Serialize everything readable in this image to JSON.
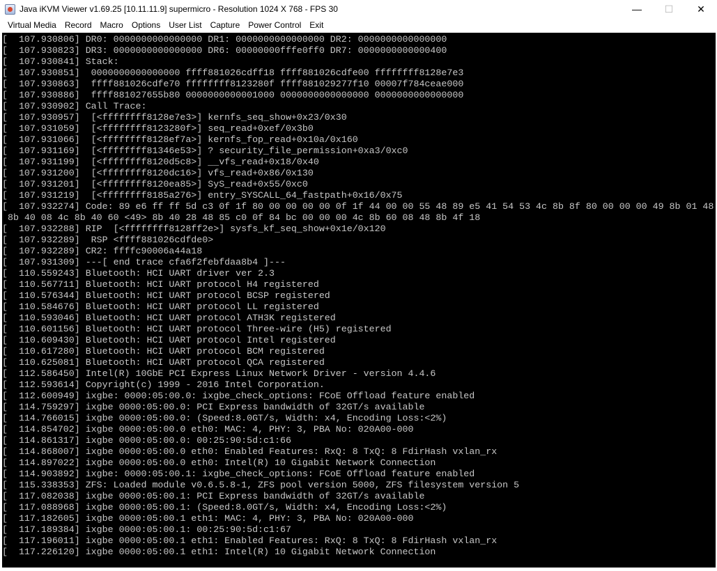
{
  "window": {
    "title": "Java iKVM Viewer v1.69.25 [10.11.11.9] supermicro - Resolution 1024 X 768 - FPS 30",
    "controls": {
      "minimize": "—",
      "maximize": "☐",
      "close": "✕"
    }
  },
  "menu": {
    "items": [
      "Virtual Media",
      "Record",
      "Macro",
      "Options",
      "User List",
      "Capture",
      "Power Control",
      "Exit"
    ]
  },
  "console": {
    "lines": [
      "[  107.930806] DR0: 0000000000000000 DR1: 0000000000000000 DR2: 0000000000000000",
      "[  107.930823] DR3: 0000000000000000 DR6: 00000000fffe0ff0 DR7: 0000000000000400",
      "[  107.930841] Stack:",
      "[  107.930851]  0000000000000000 ffff881026cdff18 ffff881026cdfe00 ffffffff8128e7e3",
      "[  107.930863]  ffff881026cdfe70 ffffffff8123280f ffff881029277f10 00007f784ceae000",
      "[  107.930886]  ffff881027655b80 0000000000001000 0000000000000000 0000000000000000",
      "[  107.930902] Call Trace:",
      "[  107.930957]  [<ffffffff8128e7e3>] kernfs_seq_show+0x23/0x30",
      "[  107.931059]  [<ffffffff8123280f>] seq_read+0xef/0x3b0",
      "[  107.931066]  [<ffffffff8128ef7a>] kernfs_fop_read+0x10a/0x160",
      "[  107.931169]  [<ffffffff81346e53>] ? security_file_permission+0xa3/0xc0",
      "[  107.931199]  [<ffffffff8120d5c8>] __vfs_read+0x18/0x40",
      "[  107.931200]  [<ffffffff8120dc16>] vfs_read+0x86/0x130",
      "[  107.931201]  [<ffffffff8120ea85>] SyS_read+0x55/0xc0",
      "[  107.931219]  [<ffffffff8185a276>] entry_SYSCALL_64_fastpath+0x16/0x75",
      "[  107.932274] Code: 89 e6 ff ff 5d c3 0f 1f 80 00 00 00 00 0f 1f 44 00 00 55 48 89 e5 41 54 53 4c 8b 8f 80 00 00 00 49 8b 01 48",
      " 8b 40 08 4c 8b 40 60 <49> 8b 40 28 48 85 c0 0f 84 bc 00 00 00 4c 8b 60 08 48 8b 4f 18",
      "[  107.932288] RIP  [<ffffffff8128ff2e>] sysfs_kf_seq_show+0x1e/0x120",
      "[  107.932289]  RSP <ffff881026cdfde0>",
      "[  107.932289] CR2: ffffc90006a44a18",
      "[  107.931309] ---[ end trace cfa6f2febfdaa8b4 ]---",
      "[  110.559243] Bluetooth: HCI UART driver ver 2.3",
      "[  110.567711] Bluetooth: HCI UART protocol H4 registered",
      "[  110.576344] Bluetooth: HCI UART protocol BCSP registered",
      "[  110.584676] Bluetooth: HCI UART protocol LL registered",
      "[  110.593046] Bluetooth: HCI UART protocol ATH3K registered",
      "[  110.601156] Bluetooth: HCI UART protocol Three-wire (H5) registered",
      "[  110.609430] Bluetooth: HCI UART protocol Intel registered",
      "[  110.617280] Bluetooth: HCI UART protocol BCM registered",
      "[  110.625081] Bluetooth: HCI UART protocol QCA registered",
      "[  112.586450] Intel(R) 10GbE PCI Express Linux Network Driver - version 4.4.6",
      "[  112.593614] Copyright(c) 1999 - 2016 Intel Corporation.",
      "[  112.600949] ixgbe: 0000:05:00.0: ixgbe_check_options: FCoE Offload feature enabled",
      "[  114.759297] ixgbe 0000:05:00.0: PCI Express bandwidth of 32GT/s available",
      "[  114.766015] ixgbe 0000:05:00.0: (Speed:8.0GT/s, Width: x4, Encoding Loss:<2%)",
      "[  114.854702] ixgbe 0000:05:00.0 eth0: MAC: 4, PHY: 3, PBA No: 020A00-000",
      "[  114.861317] ixgbe 0000:05:00.0: 00:25:90:5d:c1:66",
      "[  114.868007] ixgbe 0000:05:00.0 eth0: Enabled Features: RxQ: 8 TxQ: 8 FdirHash vxlan_rx",
      "[  114.897022] ixgbe 0000:05:00.0 eth0: Intel(R) 10 Gigabit Network Connection",
      "[  114.903892] ixgbe: 0000:05:00.1: ixgbe_check_options: FCoE Offload feature enabled",
      "[  115.338353] ZFS: Loaded module v0.6.5.8-1, ZFS pool version 5000, ZFS filesystem version 5",
      "[  117.082038] ixgbe 0000:05:00.1: PCI Express bandwidth of 32GT/s available",
      "[  117.088968] ixgbe 0000:05:00.1: (Speed:8.0GT/s, Width: x4, Encoding Loss:<2%)",
      "[  117.182605] ixgbe 0000:05:00.1 eth1: MAC: 4, PHY: 3, PBA No: 020A00-000",
      "[  117.189384] ixgbe 0000:05:00.1: 00:25:90:5d:c1:67",
      "[  117.196011] ixgbe 0000:05:00.1 eth1: Enabled Features: RxQ: 8 TxQ: 8 FdirHash vxlan_rx",
      "[  117.226120] ixgbe 0000:05:00.1 eth1: Intel(R) 10 Gigabit Network Connection"
    ]
  }
}
